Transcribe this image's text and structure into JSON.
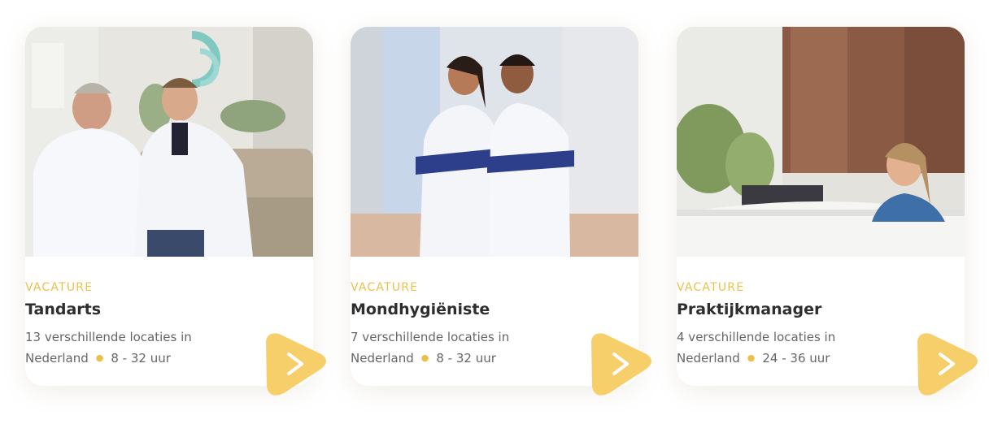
{
  "colors": {
    "accent": "#edc04c",
    "arrow_bg": "#f6cf6b",
    "title": "#2e2e2e",
    "text": "#666666"
  },
  "cards": [
    {
      "image": "photo-two-dentists-in-white-coats",
      "tag": "VACATURE",
      "title": "Tandarts",
      "locations": "13 verschillende locaties in",
      "country": "Nederland",
      "hours": "8 - 32 uur",
      "icon": "chevron-right-icon"
    },
    {
      "image": "photo-two-hygienists-arms-crossed",
      "tag": "VACATURE",
      "title": "Mondhygiëniste",
      "locations": "7 verschillende locaties in",
      "country": "Nederland",
      "hours": "8 - 32 uur",
      "icon": "chevron-right-icon"
    },
    {
      "image": "photo-receptionist-at-desk",
      "tag": "VACATURE",
      "title": "Praktijkmanager",
      "locations": "4 verschillende locaties in",
      "country": "Nederland",
      "hours": "24 - 36 uur",
      "icon": "chevron-right-icon"
    }
  ]
}
